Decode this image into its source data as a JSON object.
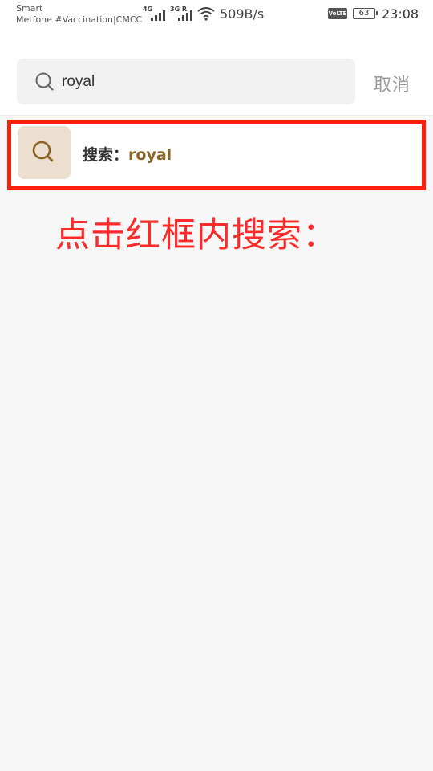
{
  "status_bar": {
    "carrier_line1": "Smart",
    "carrier_line2": "Metfone #Vaccination|CMCC",
    "signal1_tag": "4G",
    "signal2_tag": "3G R",
    "wifi_icon": "wifi-icon",
    "net_speed": "509B/s",
    "volte": "VoLTE",
    "battery": "63",
    "time": "23:08"
  },
  "search": {
    "query": "royal",
    "icon": "search-icon",
    "cancel_label": "取消"
  },
  "suggestion": {
    "prefix": "搜索：",
    "query": "royal",
    "icon": "search-icon"
  },
  "annotation": {
    "text": "点击红框内搜索：",
    "frame_color": "#ff1f0a"
  },
  "colors": {
    "accent": "#8b6225",
    "icon_bg": "#ecdfd0",
    "annotation": "#ff2a2a",
    "cancel": "#9a9a9a"
  }
}
